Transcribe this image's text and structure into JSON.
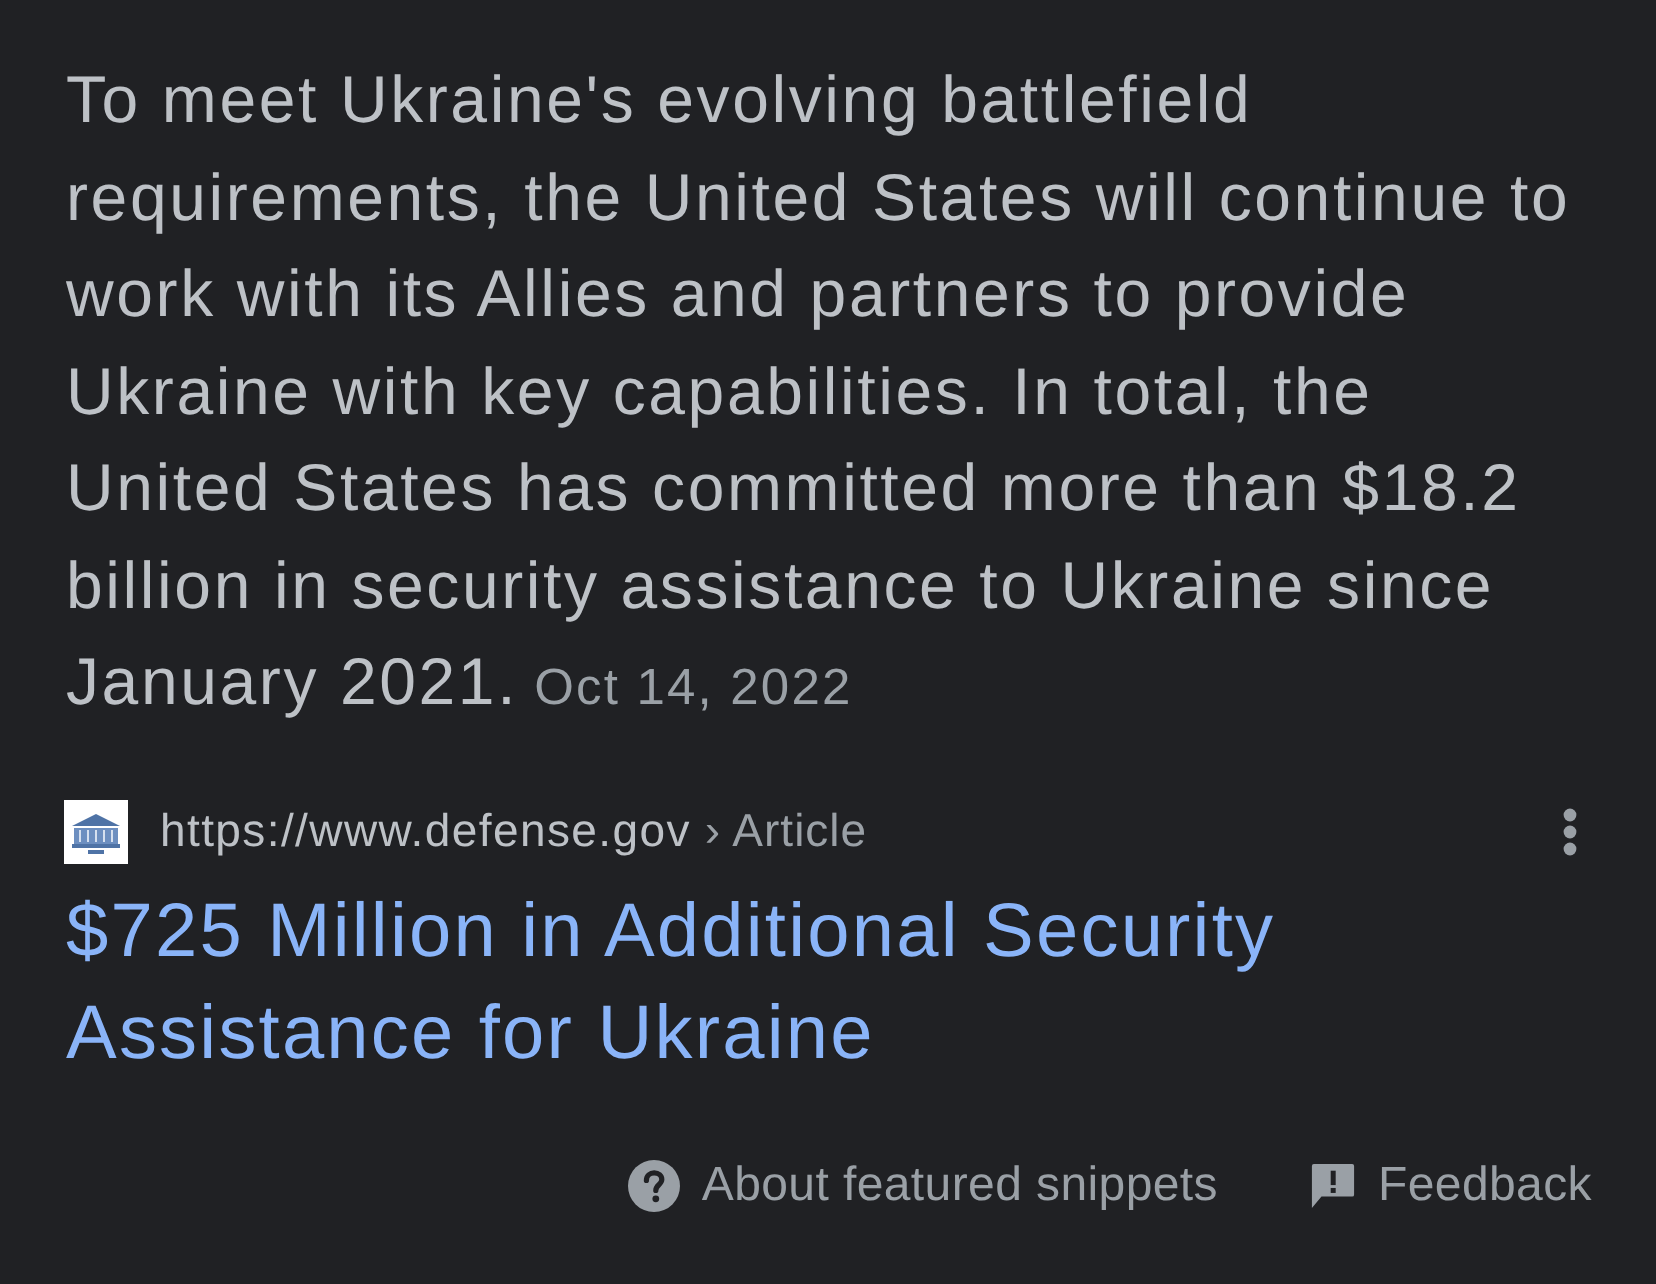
{
  "snippet": {
    "text": "To meet Ukraine's evolving battlefield requirements, the United States will continue to work with its Allies and partners to provide Ukraine with key capabilities. In total, the United States has committed more than $18.2 billion in security assistance to Ukraine since January 2021.",
    "date": "Oct 14, 2022"
  },
  "source": {
    "url": "https://www.defense.gov",
    "breadcrumb": "› Article",
    "title": "$725 Million in Additional Security Assistance for Ukraine"
  },
  "footer": {
    "links": [
      {
        "kind": "about",
        "label": "About featured snippets"
      },
      {
        "kind": "feedback",
        "label": "Feedback"
      }
    ]
  }
}
